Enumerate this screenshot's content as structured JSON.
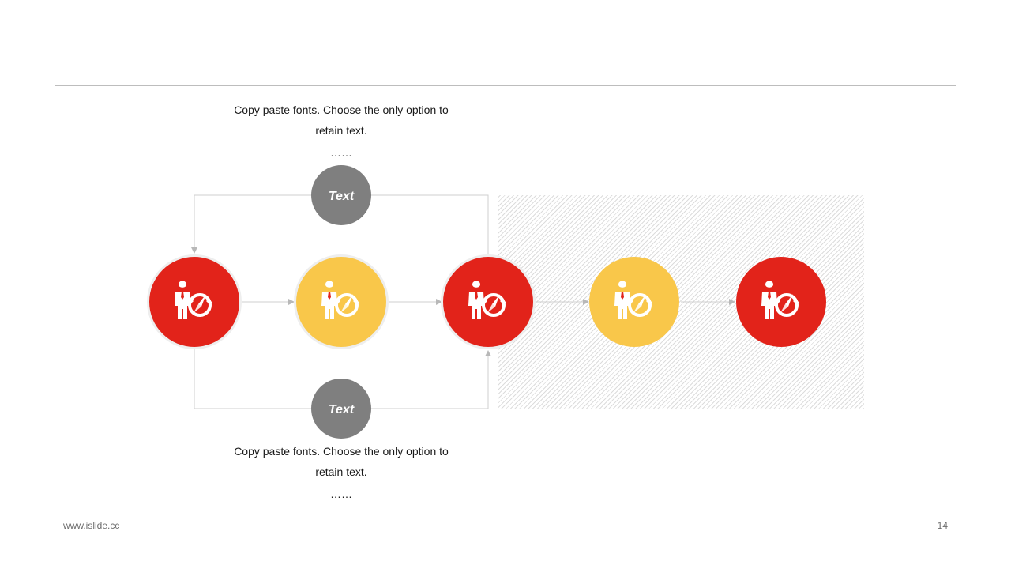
{
  "colors": {
    "red": "#e2231a",
    "yellow": "#f9c74a",
    "gray": "#7f7f7f",
    "line": "#cfcfcf",
    "arrow": "#b8b8b8"
  },
  "top_caption": {
    "line1": "Copy paste fonts. Choose the only option to",
    "line2": "retain text.",
    "dots": "……"
  },
  "bottom_caption": {
    "line1": "Copy paste fonts. Choose the only option to",
    "line2": "retain text.",
    "dots": "……"
  },
  "top_node": {
    "label": "Text"
  },
  "bottom_node": {
    "label": "Text"
  },
  "step_nodes": [
    {
      "color": "red",
      "icon": "businessman-compass-icon"
    },
    {
      "color": "yellow",
      "icon": "businessman-compass-icon"
    },
    {
      "color": "red",
      "icon": "businessman-compass-icon"
    },
    {
      "color": "yellow",
      "icon": "businessman-compass-icon"
    },
    {
      "color": "red",
      "icon": "businessman-compass-icon"
    }
  ],
  "footer": {
    "url": "www.islide.cc",
    "page_number": "14"
  }
}
